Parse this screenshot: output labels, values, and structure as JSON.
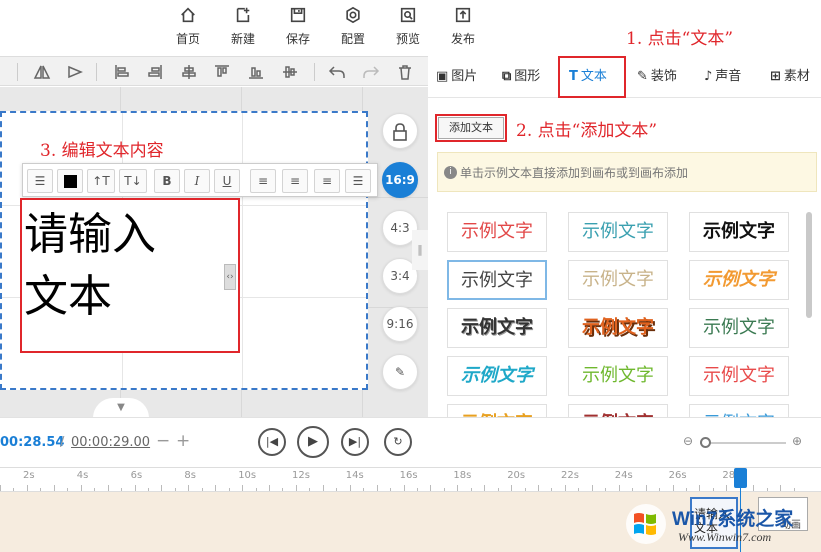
{
  "menu": {
    "home": "首页",
    "new": "新建",
    "save": "保存",
    "config": "配置",
    "preview": "预览",
    "publish": "发布"
  },
  "annotations": {
    "step1": "1. 点击“文本”",
    "step2": "2. 点击“添加文本”",
    "step3": "3. 编辑文本内容"
  },
  "tabs": {
    "image": "图片",
    "shape": "图形",
    "text": "文本",
    "decor": "装饰",
    "sound": "声音",
    "material": "素材"
  },
  "panel": {
    "add_text_label": "添加文本",
    "hint": "单击示例文本直接添加到画布或到画布添加",
    "sample_text": "示例文字"
  },
  "canvas": {
    "text_line1": "请输入",
    "text_line2": "文本"
  },
  "ratios": [
    "16:9",
    "4:3",
    "3:4",
    "9:16"
  ],
  "format": {
    "bold": "B",
    "italic": "I",
    "underline": "U",
    "font_up": "↑T",
    "font_down": "T↓"
  },
  "timeline": {
    "current": "00:28.54",
    "separator": "/",
    "total": "00:00:29.00",
    "ticks": [
      "2s",
      "4s",
      "6s",
      "8s",
      "10s",
      "12s",
      "14s",
      "16s",
      "18s",
      "20s",
      "22s",
      "24s",
      "26s",
      "28s"
    ],
    "clip_label": "请输入文本",
    "clip2_label": "动画"
  },
  "watermark": {
    "brand": "Win7系统之家",
    "url": "Www.Winwin7.com"
  },
  "colors": {
    "accent": "#1a7fd6",
    "annotation": "#e0262b"
  }
}
